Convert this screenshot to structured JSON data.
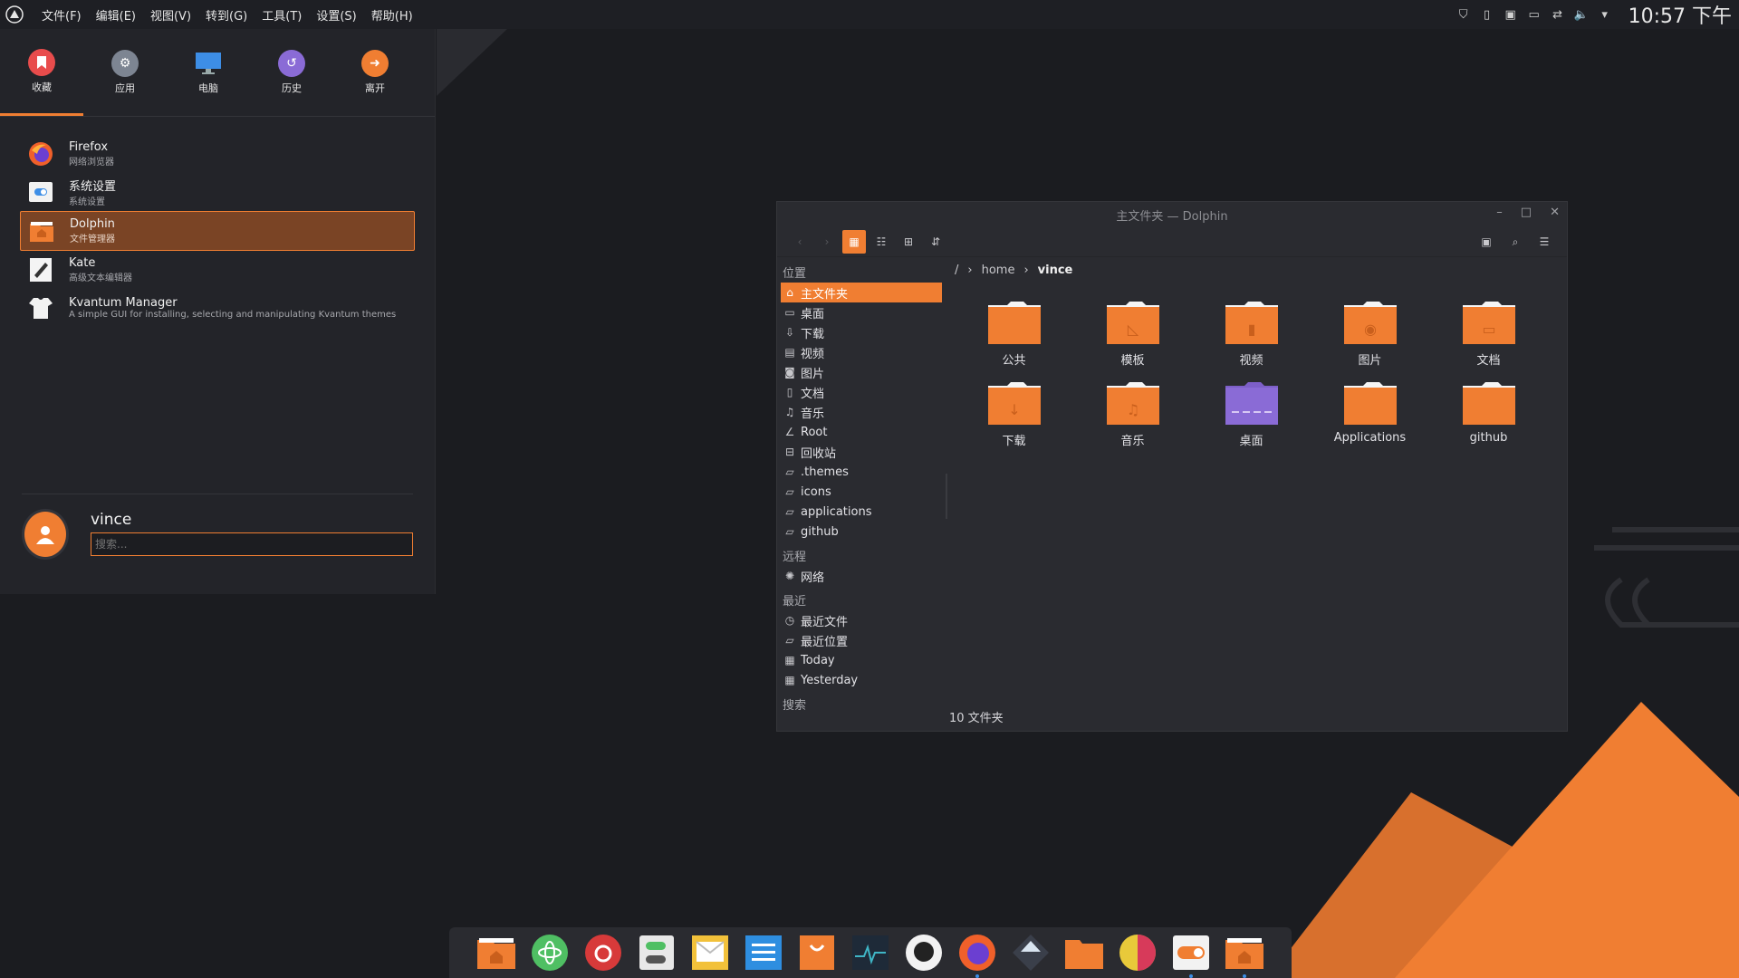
{
  "colors": {
    "accent": "#f07e32",
    "panel": "#1e1f24",
    "window": "#2a2b30",
    "background": "#1b1c20"
  },
  "menubar": {
    "logo_icon": "app-launcher-icon",
    "items": [
      "文件(F)",
      "编辑(E)",
      "视图(V)",
      "转到(G)",
      "工具(T)",
      "设置(S)",
      "帮助(H)"
    ]
  },
  "tray": {
    "icons": [
      "shield-icon",
      "clipboard-icon",
      "screenshot-icon",
      "battery-icon",
      "network-icon",
      "volume-icon",
      "arrow-down-icon"
    ],
    "clock": "10:57 下午"
  },
  "launcher": {
    "tabs": [
      {
        "label": "收藏",
        "icon": "bookmark-icon",
        "color": "#e84c4c"
      },
      {
        "label": "应用",
        "icon": "gear-icon",
        "color": "#7d8592"
      },
      {
        "label": "电脑",
        "icon": "monitor-icon",
        "color": "#3d8ee6"
      },
      {
        "label": "历史",
        "icon": "history-icon",
        "color": "#8a6bd6"
      },
      {
        "label": "离开",
        "icon": "leave-icon",
        "color": "#f07e32"
      }
    ],
    "apps": [
      {
        "name": "Firefox",
        "desc": "网络浏览器"
      },
      {
        "name": "系统设置",
        "desc": "系统设置"
      },
      {
        "name": "Dolphin",
        "desc": "文件管理器"
      },
      {
        "name": "Kate",
        "desc": "高级文本编辑器"
      },
      {
        "name": "Kvantum Manager",
        "desc": "A simple GUI for installing, selecting and manipulating Kvantum themes"
      }
    ],
    "user": {
      "name": "vince"
    },
    "search": {
      "placeholder": "搜索..."
    }
  },
  "dolphin": {
    "title": "主文件夹 — Dolphin",
    "places": {
      "section": "位置",
      "items": [
        {
          "label": "主文件夹",
          "icon": "home-icon"
        },
        {
          "label": "桌面",
          "icon": "desktop-icon"
        },
        {
          "label": "下载",
          "icon": "download-icon"
        },
        {
          "label": "视频",
          "icon": "video-icon"
        },
        {
          "label": "图片",
          "icon": "picture-icon"
        },
        {
          "label": "文档",
          "icon": "document-icon"
        },
        {
          "label": "音乐",
          "icon": "music-icon"
        },
        {
          "label": "Root",
          "icon": "root-icon"
        },
        {
          "label": "回收站",
          "icon": "trash-icon"
        },
        {
          "label": ".themes",
          "icon": "folder-icon"
        },
        {
          "label": "icons",
          "icon": "folder-icon"
        },
        {
          "label": "applications",
          "icon": "folder-icon"
        },
        {
          "label": "github",
          "icon": "folder-icon"
        }
      ]
    },
    "remote": {
      "section": "远程",
      "items": [
        {
          "label": "网络",
          "icon": "network-icon"
        }
      ]
    },
    "recent": {
      "section": "最近",
      "items": [
        {
          "label": "最近文件",
          "icon": "recent-files-icon"
        },
        {
          "label": "最近位置",
          "icon": "recent-locations-icon"
        },
        {
          "label": "Today",
          "icon": "calendar-icon"
        },
        {
          "label": "Yesterday",
          "icon": "calendar-icon"
        }
      ]
    },
    "search_section": "搜索",
    "breadcrumb": {
      "root": "/",
      "parts": [
        "home",
        "vince"
      ]
    },
    "files": [
      {
        "name": "公共",
        "glyph": ""
      },
      {
        "name": "模板",
        "glyph": "◺"
      },
      {
        "name": "视频",
        "glyph": "▮"
      },
      {
        "name": "图片",
        "glyph": "◉"
      },
      {
        "name": "文档",
        "glyph": "▭"
      },
      {
        "name": "下载",
        "glyph": "↓"
      },
      {
        "name": "音乐",
        "glyph": "♫"
      },
      {
        "name": "桌面",
        "glyph": ""
      },
      {
        "name": "Applications",
        "glyph": ""
      },
      {
        "name": "github",
        "glyph": ""
      }
    ],
    "status": "10 文件夹"
  },
  "dock": {
    "items": [
      "files-icon",
      "atom-icon",
      "netease-music-icon",
      "settings-toggle-icon",
      "mail-icon",
      "kate-icon",
      "store-icon",
      "system-monitor-icon",
      "github-icon",
      "firefox-icon",
      "kvantum-icon",
      "folder-icon",
      "krita-icon",
      "toggle-icon",
      "dolphin-icon"
    ]
  }
}
